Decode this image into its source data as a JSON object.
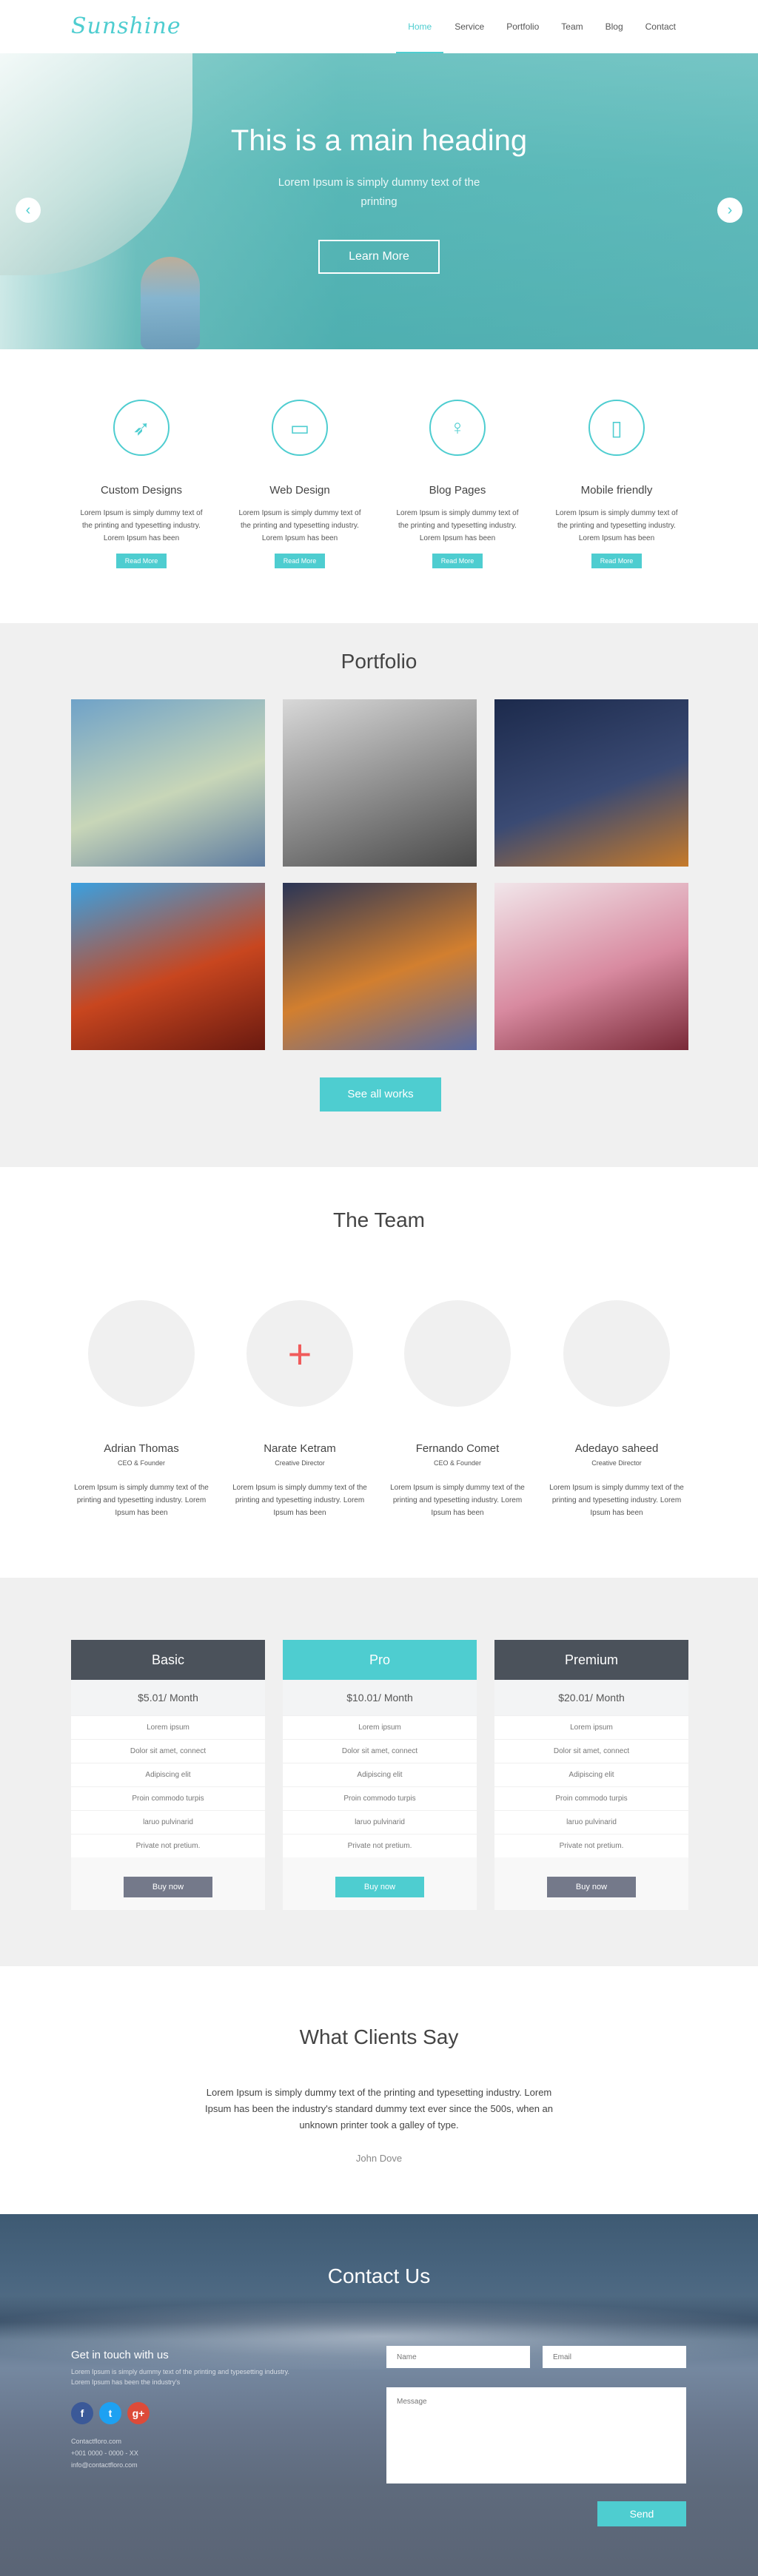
{
  "nav": {
    "logo": "Sunshine",
    "items": [
      "Home",
      "Service",
      "Portfolio",
      "Team",
      "Blog",
      "Contact"
    ]
  },
  "hero": {
    "heading": "This is a main heading",
    "subtext": "Lorem Ipsum is simply dummy text of the printing",
    "button": "Learn More",
    "prev_icon": "chevron-left-icon",
    "next_icon": "chevron-right-icon",
    "prev_glyph": "‹",
    "next_glyph": "›"
  },
  "services": [
    {
      "title": "Custom Designs",
      "icon": "rocket-icon",
      "glyph": "➶",
      "text": "Lorem Ipsum is simply dummy text of the printing and typesetting industry. Lorem Ipsum has been",
      "button": "Read More"
    },
    {
      "title": "Web Design",
      "icon": "monitor-icon",
      "glyph": "▭",
      "text": "Lorem Ipsum is simply dummy text of the printing and typesetting industry. Lorem Ipsum has been",
      "button": "Read More"
    },
    {
      "title": "Blog Pages",
      "icon": "lightbulb-icon",
      "glyph": "♀",
      "text": "Lorem Ipsum is simply dummy text of the printing and typesetting industry. Lorem Ipsum has been",
      "button": "Read More"
    },
    {
      "title": "Mobile friendly",
      "icon": "mobile-icon",
      "glyph": "▯",
      "text": "Lorem Ipsum is simply dummy text of the printing and typesetting industry. Lorem Ipsum has been",
      "button": "Read More"
    }
  ],
  "portfolio": {
    "title": "Portfolio",
    "button": "See all works",
    "tiles": [
      {
        "name": "mountain-cliff-photo",
        "colors": [
          "#6fa2c8",
          "#c8d6b8",
          "#5e7ca0"
        ]
      },
      {
        "name": "photographer-photo",
        "colors": [
          "#d8d8d8",
          "#8a8a8a",
          "#4a4a4a"
        ]
      },
      {
        "name": "tokyo-tower-night-photo",
        "colors": [
          "#1c2a4c",
          "#3a4a73",
          "#c67a2a"
        ]
      },
      {
        "name": "lantern-street-photo",
        "colors": [
          "#3aa0e0",
          "#c8461f",
          "#6a1a10"
        ]
      },
      {
        "name": "city-lights-bokeh-photo",
        "colors": [
          "#2a3556",
          "#d27f2f",
          "#5a6aa0"
        ]
      },
      {
        "name": "cherry-blossom-photo",
        "colors": [
          "#f1e6ea",
          "#d88aa0",
          "#7a2a38"
        ]
      }
    ]
  },
  "team": {
    "title": "The Team",
    "members": [
      {
        "name": "Adrian Thomas",
        "role": "CEO & Founder",
        "text": "Lorem Ipsum is simply dummy text of the printing and typesetting industry. Lorem Ipsum has been",
        "avatar": ""
      },
      {
        "name": "Narate Ketram",
        "role": "Creative Director",
        "text": "Lorem Ipsum is simply dummy text of the printing and typesetting industry. Lorem Ipsum has been",
        "avatar": "+"
      },
      {
        "name": "Fernando Comet",
        "role": "CEO & Founder",
        "text": "Lorem Ipsum is simply dummy text of the printing and typesetting industry. Lorem Ipsum has been",
        "avatar": ""
      },
      {
        "name": "Adedayo saheed",
        "role": "Creative Director",
        "text": "Lorem Ipsum is simply dummy text of the printing and typesetting industry. Lorem Ipsum has been",
        "avatar": ""
      }
    ]
  },
  "pricing": [
    {
      "name": "Basic",
      "price": "$5.01/ Month",
      "features": [
        "Lorem ipsum",
        "Dolor sit amet, connect",
        "Adipiscing elit",
        "Proin commodo turpis",
        "laruo pulvinarid",
        "Private not pretium."
      ],
      "button": "Buy now"
    },
    {
      "name": "Pro",
      "price": "$10.01/ Month",
      "features": [
        "Lorem ipsum",
        "Dolor sit amet, connect",
        "Adipiscing elit",
        "Proin commodo turpis",
        "laruo pulvinarid",
        "Private not pretium."
      ],
      "button": "Buy now"
    },
    {
      "name": "Premium",
      "price": "$20.01/ Month",
      "features": [
        "Lorem ipsum",
        "Dolor sit amet, connect",
        "Adipiscing elit",
        "Proin commodo turpis",
        "laruo pulvinarid",
        "Private not pretium."
      ],
      "button": "Buy now"
    }
  ],
  "clients": {
    "title": "What Clients Say",
    "quote": "Lorem Ipsum is simply dummy text of the printing and typesetting industry. Lorem Ipsum has been the industry's standard dummy text ever since the 500s, when an unknown printer took a galley of type.",
    "author": "John Dove"
  },
  "contact": {
    "title": "Contact Us",
    "get_in_touch": "Get in touch with us",
    "intro": "Lorem Ipsum is simply dummy text of the printing and typesetting industry. Lorem Ipsum has been the industry's",
    "socials": [
      {
        "name": "facebook-icon",
        "glyph": "f",
        "color": "#3b5998"
      },
      {
        "name": "twitter-icon",
        "glyph": "t",
        "color": "#1da1f2"
      },
      {
        "name": "google-plus-icon",
        "glyph": "g+",
        "color": "#dd4b39"
      }
    ],
    "info": [
      "Contactfloro.com",
      "+001 0000 - 0000 - XX",
      "info@contactfloro.com"
    ],
    "name_placeholder": "Name",
    "email_placeholder": "Email",
    "message_placeholder": "Message",
    "send": "Send"
  },
  "colors": {
    "accent": "#4ecdd0",
    "dark": "#4b525b",
    "light_bg": "#f0f0f0"
  }
}
